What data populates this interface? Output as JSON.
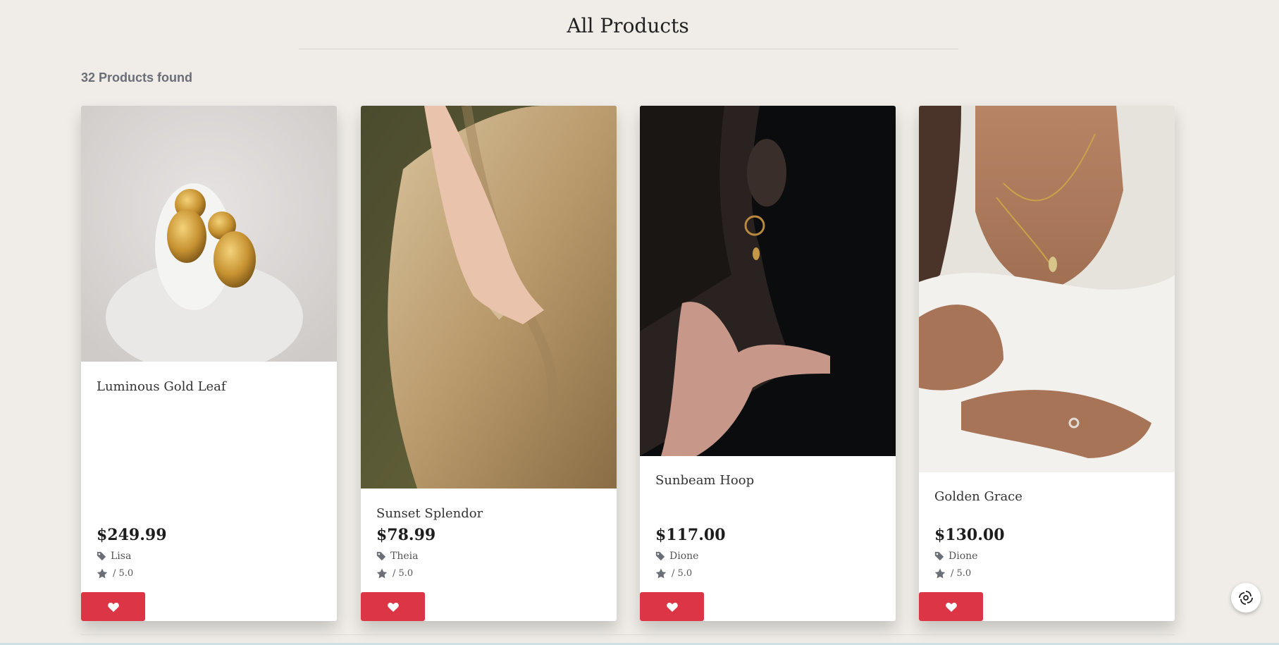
{
  "page": {
    "title": "All Products",
    "results_count": "32 Products found"
  },
  "colors": {
    "background": "#f0ede8",
    "wishlist_button": "#dc3545",
    "card": "#ffffff"
  },
  "products": [
    {
      "name": "Luminous Gold Leaf",
      "price": "$249.99",
      "brand": "Lisa",
      "rating_suffix": "/ 5.0",
      "wishlist_icon": "heart-icon"
    },
    {
      "name": "Sunset Splendor",
      "price": "$78.99",
      "brand": "Theia",
      "rating_suffix": "/ 5.0",
      "wishlist_icon": "heart-icon"
    },
    {
      "name": "Sunbeam Hoop",
      "price": "$117.00",
      "brand": "Dione",
      "rating_suffix": "/ 5.0",
      "wishlist_icon": "heart-icon"
    },
    {
      "name": "Golden Grace",
      "price": "$130.00",
      "brand": "Dione",
      "rating_suffix": "/ 5.0",
      "wishlist_icon": "heart-icon"
    }
  ],
  "icons": {
    "brand": "tag-icon",
    "rating": "star-icon",
    "wishlist": "heart-icon",
    "widget": "swirl-logo-icon"
  }
}
